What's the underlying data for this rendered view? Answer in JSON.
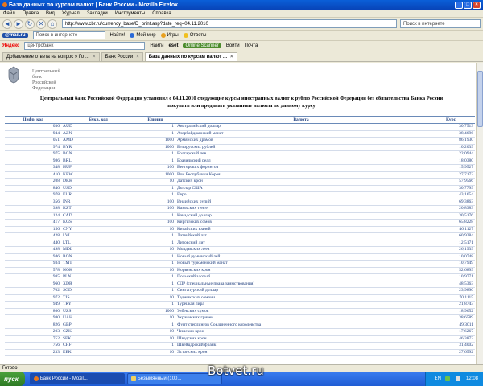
{
  "window": {
    "title": "База данных по курсам валют | Банк России - Mozilla Firefox",
    "min": "_",
    "max": "□",
    "close": "×"
  },
  "menu": [
    "Файл",
    "Правка",
    "Вид",
    "Журнал",
    "Закладки",
    "Инструменты",
    "Справка"
  ],
  "nav": {
    "back": "◄",
    "forward": "►",
    "reload": "↻",
    "stop": "✕",
    "home": "⌂",
    "url": "http://www.cbr.ru/currency_base/D_print.asp?date_req=04.11.2010",
    "search_placeholder": "Поиск в интернете",
    "search_button": "Найти!"
  },
  "toolbar1": {
    "mailru": "@mail.ru",
    "search_placeholder": "Поиск в интернете",
    "find": "Найти!",
    "my_world": "Мой мир",
    "games": "Игры",
    "answers": "Ответы"
  },
  "toolbar2": {
    "yandex": "Яндекс",
    "query": "центробанк",
    "find": "Найти",
    "eset": "eset",
    "online_scanner": "Online Scanner",
    "login": "Войти",
    "mail": "Почта"
  },
  "tabs": [
    {
      "label": "Добавление ответа на вопрос » Гот...",
      "active": false
    },
    {
      "label": "Банк России",
      "active": false
    },
    {
      "label": "База данных по курсам валют ...",
      "active": true
    }
  ],
  "page": {
    "bank_name_lines": [
      "Центральный",
      "банк",
      "Российской",
      "Федерации"
    ],
    "intro_line1": "Центральный банк Российской Федерации установил с 04.11.2010 следующие курсы иностранных валют к рублю Российской Федерации без обязательства Банка России",
    "intro_line2": "покупать или продавать указанные валюты по данному курсу"
  },
  "table": {
    "headers": [
      "Цифр. код",
      "Букв. код",
      "Единиц",
      "Валюта",
      "Курс"
    ],
    "rows": [
      [
        "036",
        "AUD",
        "1",
        "Австралийский доллар",
        "30,7513"
      ],
      [
        "944",
        "AZN",
        "1",
        "Азербайджанский манат",
        "38,4696"
      ],
      [
        "051",
        "AMD",
        "1000",
        "Армянских драмов",
        "86,1930"
      ],
      [
        "974",
        "BYR",
        "1000",
        "Белорусских рублей",
        "10,2039"
      ],
      [
        "975",
        "BGN",
        "1",
        "Болгарский лев",
        "22,0944"
      ],
      [
        "986",
        "BRL",
        "1",
        "Бразильский реал",
        "18,0380"
      ],
      [
        "348",
        "HUF",
        "100",
        "Венгерских форинтов",
        "15,9527"
      ],
      [
        "410",
        "KRW",
        "1000",
        "Вон Республики Корея",
        "27,7173"
      ],
      [
        "208",
        "DKK",
        "10",
        "Датских крон",
        "57,9566"
      ],
      [
        "840",
        "USD",
        "1",
        "Доллар США",
        "30,7799"
      ],
      [
        "978",
        "EUR",
        "1",
        "Евро",
        "43,1654"
      ],
      [
        "356",
        "INR",
        "100",
        "Индийских рупий",
        "69,3863"
      ],
      [
        "398",
        "KZT",
        "100",
        "Казахских тенге",
        "20,8383"
      ],
      [
        "124",
        "CAD",
        "1",
        "Канадский доллар",
        "30,5176"
      ],
      [
        "417",
        "KGS",
        "100",
        "Киргизских сомов",
        "65,8228"
      ],
      [
        "156",
        "CNY",
        "10",
        "Китайских юаней",
        "46,1127"
      ],
      [
        "428",
        "LVL",
        "1",
        "Латвийский лат",
        "60,9284"
      ],
      [
        "440",
        "LTL",
        "1",
        "Литовский лит",
        "12,5171"
      ],
      [
        "498",
        "MDL",
        "10",
        "Молдавских леев",
        "26,1939"
      ],
      [
        "946",
        "RON",
        "1",
        "Новый румынский лей",
        "10,0748"
      ],
      [
        "934",
        "TMT",
        "1",
        "Новый туркменский манат",
        "10,7949"
      ],
      [
        "578",
        "NOK",
        "10",
        "Норвежских крон",
        "52,6899"
      ],
      [
        "985",
        "PLN",
        "1",
        "Польский злотый",
        "10,9771"
      ],
      [
        "960",
        "XDR",
        "1",
        "СДР (специальные права заимствования)",
        "48,5363"
      ],
      [
        "702",
        "SGD",
        "1",
        "Сингапурский доллар",
        "23,9890"
      ],
      [
        "972",
        "TJS",
        "10",
        "Таджикских сомони",
        "70,1115"
      ],
      [
        "949",
        "TRY",
        "1",
        "Турецкая лира",
        "21,8743"
      ],
      [
        "860",
        "UZS",
        "1000",
        "Узбекских сумов",
        "18,9652"
      ],
      [
        "980",
        "UAH",
        "10",
        "Украинских гривен",
        "38,6589"
      ],
      [
        "826",
        "GBP",
        "1",
        "Фунт стерлингов Соединенного королевства",
        "49,3011"
      ],
      [
        "203",
        "CZK",
        "10",
        "Чешских крон",
        "17,6267"
      ],
      [
        "752",
        "SEK",
        "10",
        "Шведских крон",
        "46,3873"
      ],
      [
        "756",
        "CHF",
        "1",
        "Швейцарский франк",
        "31,4002"
      ],
      [
        "233",
        "EEK",
        "10",
        "Эстонских крон",
        "27,6592"
      ]
    ]
  },
  "status": {
    "text": "Готово"
  },
  "taskbar": {
    "start": "пуск",
    "items": [
      {
        "label": "Банк России - Mozil...",
        "active": true
      },
      {
        "label": "Безымянный (100...",
        "active": false
      }
    ],
    "lang": "EN",
    "clock": "12:08"
  },
  "watermark": "Botvet.ru",
  "colors": {
    "accent": "#1f3f7f",
    "taskbar": "#1f5cd4",
    "start": "#2d7a24"
  }
}
